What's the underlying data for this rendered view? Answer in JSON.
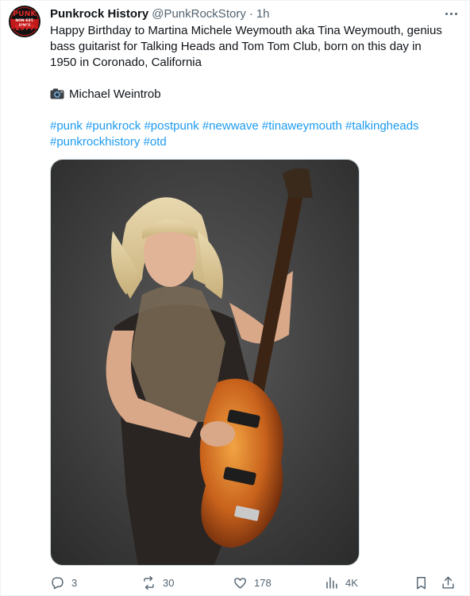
{
  "tweet": {
    "author": {
      "name": "Punkrock History",
      "handle": "@PunkRockStory",
      "avatar_text": {
        "top": "PUNK",
        "middle": "NON EST. SINCE",
        "bottom": "1977"
      }
    },
    "separator": "·",
    "time": "1h",
    "text_lines": [
      "Happy Birthday to Martina Michele Weymouth aka Tina Weymouth, genius",
      "bass guitarist for Talking Heads and Tom Tom Club, born on this day in",
      "1950 in Coronado, California"
    ],
    "credit": "Michael Weintrob",
    "hashtag_lines": [
      [
        "#punk",
        "#punkrock",
        "#postpunk",
        "#newwave",
        "#tinaweymouth",
        "#talkingheads"
      ],
      [
        "#punkrockhistory",
        "#otd"
      ]
    ],
    "media": {
      "description": "photo"
    },
    "metrics": {
      "replies": "3",
      "reposts": "30",
      "likes": "178",
      "views": "4K"
    },
    "icons": [
      "reply-icon",
      "repost-icon",
      "like-icon",
      "views-icon",
      "bookmark-icon",
      "share-icon",
      "camera-icon",
      "more-icon"
    ],
    "colors": {
      "link": "#1d9bf0",
      "secondary": "#536471",
      "text": "#0f1419"
    }
  }
}
